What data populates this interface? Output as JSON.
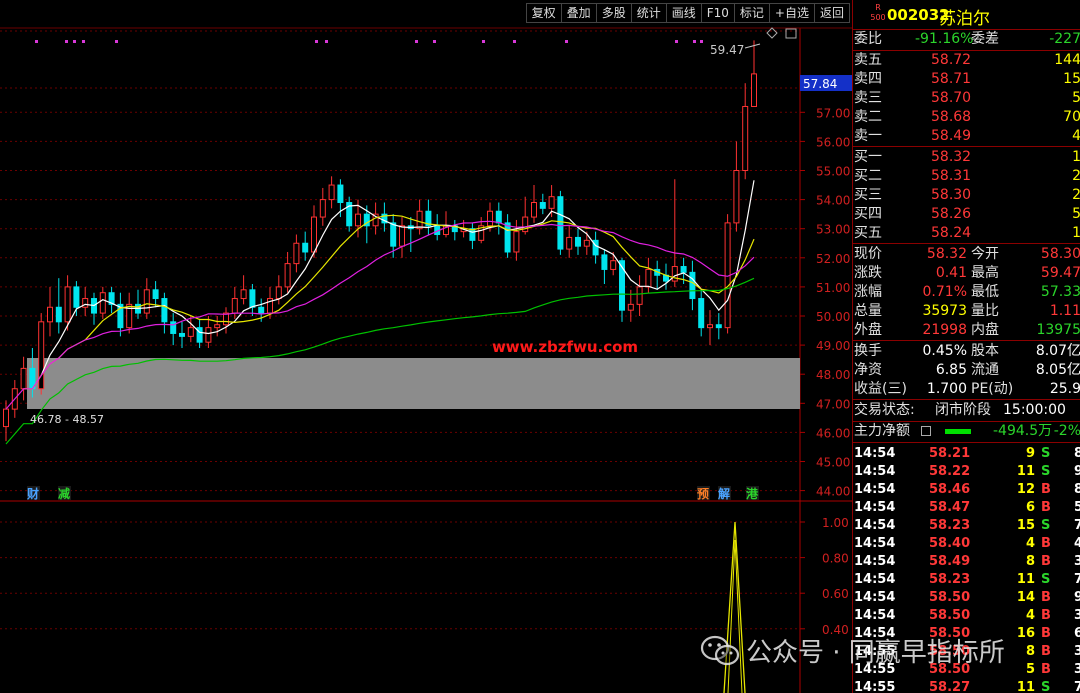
{
  "toolbar": [
    "复权",
    "叠加",
    "多股",
    "统计",
    "画线",
    "F10",
    "标记",
    "+自选",
    "返回"
  ],
  "stock": {
    "rank_badge_top": "R",
    "rank_badge_bottom": "500",
    "code": "002032",
    "name": "苏泊尔"
  },
  "price_axis": [
    "57.00",
    "56.00",
    "55.00",
    "54.00",
    "53.00",
    "52.00",
    "51.00",
    "50.00",
    "49.00",
    "48.00",
    "47.00",
    "46.00",
    "45.00",
    "44.00"
  ],
  "current_price_tag": "57.84",
  "high_label": "59.47",
  "low_label": "46.78 - 48.57",
  "site_watermark": "www.zbzfwu.com",
  "event_markers": [
    {
      "text": "财",
      "color": "#4aa3ff"
    },
    {
      "text": "减",
      "color": "#2bd52b"
    },
    {
      "text": "预",
      "color": "#ff7f27"
    },
    {
      "text": "解",
      "color": "#4aa3ff"
    },
    {
      "text": "港",
      "color": "#2bd52b"
    }
  ],
  "indicator_axis": [
    "1.00",
    "0.80",
    "0.60",
    "0.40"
  ],
  "quote": {
    "ratio": {
      "label": "委比",
      "value": "-91.16%",
      "diff_label": "委差",
      "diff_value": "-227"
    },
    "asks": [
      {
        "label": "卖五",
        "price": "58.72",
        "vol": "144"
      },
      {
        "label": "卖四",
        "price": "58.71",
        "vol": "15"
      },
      {
        "label": "卖三",
        "price": "58.70",
        "vol": "5"
      },
      {
        "label": "卖二",
        "price": "58.68",
        "vol": "70"
      },
      {
        "label": "卖一",
        "price": "58.49",
        "vol": "4"
      }
    ],
    "bids": [
      {
        "label": "买一",
        "price": "58.32",
        "vol": "1"
      },
      {
        "label": "买二",
        "price": "58.31",
        "vol": "2"
      },
      {
        "label": "买三",
        "price": "58.30",
        "vol": "2"
      },
      {
        "label": "买四",
        "price": "58.26",
        "vol": "5"
      },
      {
        "label": "买五",
        "price": "58.24",
        "vol": "1"
      }
    ],
    "stats1": [
      {
        "l1": "现价",
        "v1": "58.32",
        "l2": "今开",
        "v2": "58.30"
      },
      {
        "l1": "涨跌",
        "v1": "0.41",
        "l2": "最高",
        "v2": "59.47"
      },
      {
        "l1": "涨幅",
        "v1": "0.71%",
        "l2": "最低",
        "v2": "57.33"
      },
      {
        "l1": "总量",
        "v1": "35973",
        "l2": "量比",
        "v2": "1.11"
      },
      {
        "l1": "外盘",
        "v1": "21998",
        "l2": "内盘",
        "v2": "13975"
      }
    ],
    "stats2": [
      {
        "l1": "换手",
        "v1": "0.45%",
        "l2": "股本",
        "v2": "8.07亿"
      },
      {
        "l1": "净资",
        "v1": "6.85",
        "l2": "流通",
        "v2": "8.05亿"
      },
      {
        "l1": "收益(三)",
        "v1": "1.700",
        "l2": "PE(动)",
        "v2": "25.9"
      }
    ],
    "trade_status": {
      "label": "交易状态:",
      "value": "闭市阶段",
      "time": "15:00:00"
    },
    "main_flow": {
      "label": "主力净额",
      "value": "-494.5万",
      "pct": "-2%"
    }
  },
  "ticks": [
    {
      "t": "14:54",
      "p": "58.21",
      "v": "9",
      "s": "S",
      "n": "8"
    },
    {
      "t": "14:54",
      "p": "58.22",
      "v": "11",
      "s": "S",
      "n": "9"
    },
    {
      "t": "14:54",
      "p": "58.46",
      "v": "12",
      "s": "B",
      "n": "8"
    },
    {
      "t": "14:54",
      "p": "58.47",
      "v": "6",
      "s": "B",
      "n": "5"
    },
    {
      "t": "14:54",
      "p": "58.23",
      "v": "15",
      "s": "S",
      "n": "7"
    },
    {
      "t": "14:54",
      "p": "58.40",
      "v": "4",
      "s": "B",
      "n": "4"
    },
    {
      "t": "14:54",
      "p": "58.49",
      "v": "8",
      "s": "B",
      "n": "3"
    },
    {
      "t": "14:54",
      "p": "58.23",
      "v": "11",
      "s": "S",
      "n": "7"
    },
    {
      "t": "14:54",
      "p": "58.50",
      "v": "14",
      "s": "B",
      "n": "9"
    },
    {
      "t": "14:54",
      "p": "58.50",
      "v": "4",
      "s": "B",
      "n": "3"
    },
    {
      "t": "14:54",
      "p": "58.50",
      "v": "16",
      "s": "B",
      "n": "6"
    },
    {
      "t": "14:55",
      "p": "58.50",
      "v": "8",
      "s": "B",
      "n": "3"
    },
    {
      "t": "14:55",
      "p": "58.50",
      "v": "5",
      "s": "B",
      "n": "3"
    },
    {
      "t": "14:55",
      "p": "58.27",
      "v": "11",
      "s": "S",
      "n": "7"
    }
  ],
  "wechat_watermark": "公众号 · 同赢早指标所",
  "chart_data": {
    "type": "candlestick",
    "price_range": [
      44,
      59.47
    ],
    "candles": [
      [
        46.2,
        46.8,
        45.7,
        47.1
      ],
      [
        46.8,
        47.5,
        46.5,
        47.8
      ],
      [
        47.5,
        48.2,
        47.1,
        48.6
      ],
      [
        48.2,
        47.5,
        47.2,
        48.9
      ],
      [
        47.5,
        49.8,
        47.3,
        50.1
      ],
      [
        49.8,
        50.3,
        49.3,
        51.0
      ],
      [
        50.3,
        49.8,
        49.4,
        51.3
      ],
      [
        49.8,
        51.0,
        49.5,
        51.4
      ],
      [
        51.0,
        50.3,
        50.0,
        51.2
      ],
      [
        50.3,
        50.6,
        50.0,
        51.0
      ],
      [
        50.6,
        50.1,
        49.7,
        50.8
      ],
      [
        50.1,
        50.8,
        49.9,
        51.0
      ],
      [
        50.8,
        50.4,
        50.1,
        51.0
      ],
      [
        50.4,
        49.6,
        49.3,
        50.8
      ],
      [
        49.6,
        50.4,
        49.4,
        50.8
      ],
      [
        50.4,
        50.1,
        49.9,
        50.9
      ],
      [
        50.1,
        50.9,
        49.9,
        51.3
      ],
      [
        50.9,
        50.6,
        50.3,
        51.2
      ],
      [
        50.6,
        49.8,
        49.4,
        50.8
      ],
      [
        49.8,
        49.4,
        49.0,
        50.1
      ],
      [
        49.4,
        49.3,
        48.9,
        49.8
      ],
      [
        49.3,
        49.6,
        49.1,
        50.0
      ],
      [
        49.6,
        49.1,
        48.9,
        49.9
      ],
      [
        49.1,
        49.6,
        48.9,
        50.0
      ],
      [
        49.6,
        49.7,
        49.3,
        50.0
      ],
      [
        49.7,
        50.1,
        49.4,
        50.3
      ],
      [
        50.1,
        50.6,
        49.9,
        51.0
      ],
      [
        50.6,
        50.9,
        50.4,
        51.4
      ],
      [
        50.9,
        50.3,
        50.0,
        51.1
      ],
      [
        50.3,
        50.1,
        49.8,
        50.6
      ],
      [
        50.1,
        50.6,
        49.9,
        51.0
      ],
      [
        50.6,
        51.0,
        50.4,
        51.4
      ],
      [
        51.0,
        51.8,
        50.8,
        52.2
      ],
      [
        51.8,
        52.5,
        51.5,
        52.8
      ],
      [
        52.5,
        52.2,
        51.9,
        52.9
      ],
      [
        52.2,
        53.4,
        52.0,
        53.8
      ],
      [
        53.4,
        54.0,
        53.1,
        54.4
      ],
      [
        54.0,
        54.5,
        53.7,
        54.8
      ],
      [
        54.5,
        53.9,
        53.4,
        54.7
      ],
      [
        53.9,
        53.1,
        52.9,
        54.1
      ],
      [
        53.1,
        53.5,
        52.7,
        54.0
      ],
      [
        53.5,
        53.1,
        52.5,
        53.8
      ],
      [
        53.1,
        53.5,
        52.8,
        53.9
      ],
      [
        53.5,
        53.2,
        52.9,
        53.9
      ],
      [
        53.2,
        52.4,
        52.0,
        53.5
      ],
      [
        52.4,
        53.1,
        52.0,
        53.4
      ],
      [
        53.1,
        53.0,
        52.2,
        53.4
      ],
      [
        53.0,
        53.6,
        52.8,
        54.0
      ],
      [
        53.6,
        53.1,
        52.8,
        54.0
      ],
      [
        53.1,
        52.8,
        52.6,
        53.5
      ],
      [
        52.8,
        53.1,
        52.7,
        53.6
      ],
      [
        53.1,
        52.9,
        52.6,
        53.3
      ],
      [
        52.9,
        53.0,
        52.7,
        53.3
      ],
      [
        53.0,
        52.6,
        52.3,
        53.2
      ],
      [
        52.6,
        53.1,
        52.5,
        53.4
      ],
      [
        53.1,
        53.6,
        52.9,
        53.9
      ],
      [
        53.6,
        53.2,
        52.8,
        53.9
      ],
      [
        53.2,
        52.2,
        52.0,
        53.5
      ],
      [
        52.2,
        52.9,
        51.9,
        53.3
      ],
      [
        52.9,
        53.4,
        52.8,
        54.1
      ],
      [
        53.4,
        53.9,
        53.2,
        54.5
      ],
      [
        53.9,
        53.7,
        53.5,
        54.2
      ],
      [
        53.7,
        54.1,
        53.4,
        54.5
      ],
      [
        54.1,
        52.3,
        52.1,
        54.3
      ],
      [
        52.3,
        52.7,
        52.0,
        53.1
      ],
      [
        52.7,
        52.4,
        52.1,
        53.0
      ],
      [
        52.4,
        52.6,
        52.1,
        52.9
      ],
      [
        52.6,
        52.1,
        51.8,
        52.9
      ],
      [
        52.1,
        51.6,
        51.1,
        52.3
      ],
      [
        51.6,
        51.9,
        51.4,
        52.2
      ],
      [
        51.9,
        50.2,
        49.8,
        52.0
      ],
      [
        50.2,
        50.4,
        49.8,
        50.9
      ],
      [
        50.4,
        51.0,
        50.0,
        51.4
      ],
      [
        51.0,
        51.6,
        50.8,
        52.0
      ],
      [
        51.6,
        51.4,
        50.9,
        51.9
      ],
      [
        51.4,
        51.2,
        50.9,
        51.8
      ],
      [
        51.2,
        51.7,
        51.0,
        54.7
      ],
      [
        51.7,
        51.5,
        51.1,
        52.0
      ],
      [
        51.5,
        50.6,
        50.2,
        51.9
      ],
      [
        50.6,
        49.6,
        49.3,
        50.9
      ],
      [
        49.6,
        49.7,
        49.0,
        50.2
      ],
      [
        49.7,
        49.6,
        49.2,
        50.1
      ],
      [
        49.6,
        53.2,
        49.4,
        53.5
      ],
      [
        53.2,
        55.0,
        52.9,
        56.0
      ],
      [
        55.0,
        57.2,
        54.7,
        58.0
      ],
      [
        57.2,
        58.32,
        57.33,
        59.47
      ]
    ]
  }
}
